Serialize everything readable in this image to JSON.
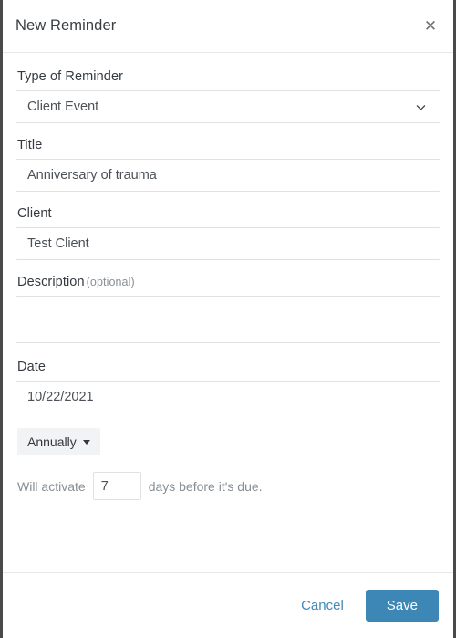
{
  "modal": {
    "title": "New Reminder",
    "close_icon": "close-icon",
    "fields": {
      "type": {
        "label": "Type of Reminder",
        "value": "Client Event",
        "placeholder": "",
        "chevron_icon": "chevron-down-icon"
      },
      "title": {
        "label": "Title",
        "value": "Anniversary of trauma",
        "placeholder": ""
      },
      "client": {
        "label": "Client",
        "value": "Test Client",
        "placeholder": ""
      },
      "description": {
        "label": "Description",
        "optional_note": "(optional)",
        "value": "",
        "placeholder": ""
      },
      "date": {
        "label": "Date",
        "value": "10/22/2021",
        "placeholder": ""
      }
    },
    "recurrence": {
      "label": "Annually",
      "caret_icon": "caret-down-icon"
    },
    "activation": {
      "prefix": "Will activate",
      "days": "7",
      "suffix": "days before it's due."
    },
    "footer": {
      "cancel_label": "Cancel",
      "save_label": "Save"
    },
    "colors": {
      "accent": "#3d87b7",
      "link": "#4089b8",
      "label": "#343a40",
      "muted": "#868e96",
      "border": "#dfe2e5",
      "chip_bg": "#f1f3f5"
    }
  }
}
